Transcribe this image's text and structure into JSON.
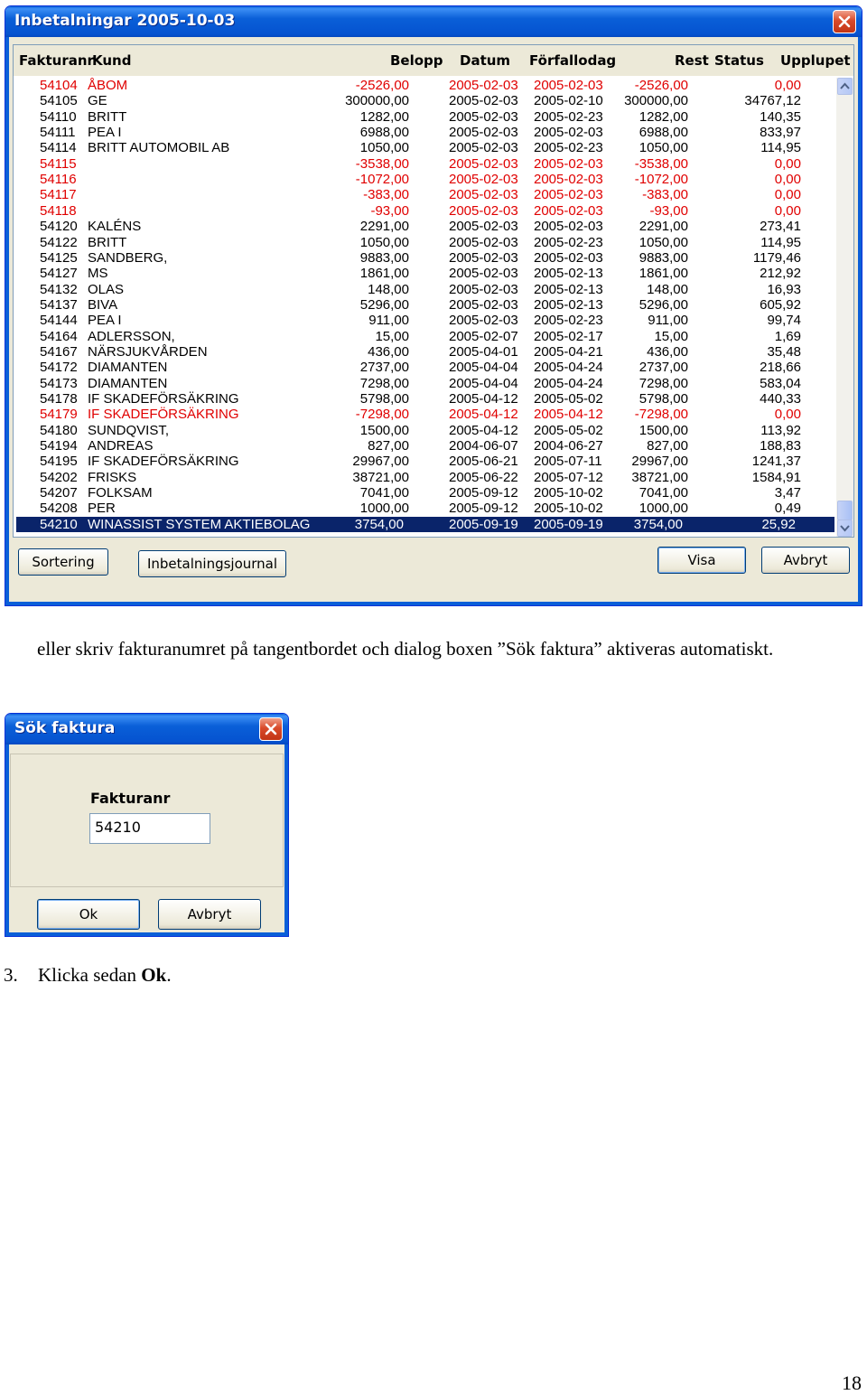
{
  "payments_window": {
    "title": "Inbetalningar 2005-10-03",
    "columns": [
      "Fakturanr",
      "Kund",
      "Belopp",
      "Datum",
      "Förfallodag",
      "Rest",
      "Status",
      "Upplupet"
    ],
    "rows": [
      {
        "nr": "54104",
        "kund": "ÅBOM",
        "belopp": "-2526,00",
        "datum": "2005-02-03",
        "forfall": "2005-02-03",
        "rest": "-2526,00",
        "upplupet": "0,00",
        "negative": true
      },
      {
        "nr": "54105",
        "kund": "GE",
        "belopp": "300000,00",
        "datum": "2005-02-03",
        "forfall": "2005-02-10",
        "rest": "300000,00",
        "upplupet": "34767,12",
        "negative": false
      },
      {
        "nr": "54110",
        "kund": "BRITT",
        "belopp": "1282,00",
        "datum": "2005-02-03",
        "forfall": "2005-02-23",
        "rest": "1282,00",
        "upplupet": "140,35",
        "negative": false
      },
      {
        "nr": "54111",
        "kund": "PEA I",
        "belopp": "6988,00",
        "datum": "2005-02-03",
        "forfall": "2005-02-03",
        "rest": "6988,00",
        "upplupet": "833,97",
        "negative": false
      },
      {
        "nr": "54114",
        "kund": "BRITT AUTOMOBIL AB",
        "belopp": "1050,00",
        "datum": "2005-02-03",
        "forfall": "2005-02-23",
        "rest": "1050,00",
        "upplupet": "114,95",
        "negative": false
      },
      {
        "nr": "54115",
        "kund": "",
        "belopp": "-3538,00",
        "datum": "2005-02-03",
        "forfall": "2005-02-03",
        "rest": "-3538,00",
        "upplupet": "0,00",
        "negative": true
      },
      {
        "nr": "54116",
        "kund": "",
        "belopp": "-1072,00",
        "datum": "2005-02-03",
        "forfall": "2005-02-03",
        "rest": "-1072,00",
        "upplupet": "0,00",
        "negative": true
      },
      {
        "nr": "54117",
        "kund": "",
        "belopp": "-383,00",
        "datum": "2005-02-03",
        "forfall": "2005-02-03",
        "rest": "-383,00",
        "upplupet": "0,00",
        "negative": true
      },
      {
        "nr": "54118",
        "kund": "",
        "belopp": "-93,00",
        "datum": "2005-02-03",
        "forfall": "2005-02-03",
        "rest": "-93,00",
        "upplupet": "0,00",
        "negative": true
      },
      {
        "nr": "54120",
        "kund": "KALÉNS",
        "belopp": "2291,00",
        "datum": "2005-02-03",
        "forfall": "2005-02-03",
        "rest": "2291,00",
        "upplupet": "273,41",
        "negative": false
      },
      {
        "nr": "54122",
        "kund": "BRITT",
        "belopp": "1050,00",
        "datum": "2005-02-03",
        "forfall": "2005-02-23",
        "rest": "1050,00",
        "upplupet": "114,95",
        "negative": false
      },
      {
        "nr": "54125",
        "kund": "SANDBERG,",
        "belopp": "9883,00",
        "datum": "2005-02-03",
        "forfall": "2005-02-03",
        "rest": "9883,00",
        "upplupet": "1179,46",
        "negative": false
      },
      {
        "nr": "54127",
        "kund": "MS",
        "belopp": "1861,00",
        "datum": "2005-02-03",
        "forfall": "2005-02-13",
        "rest": "1861,00",
        "upplupet": "212,92",
        "negative": false
      },
      {
        "nr": "54132",
        "kund": "OLAS",
        "belopp": "148,00",
        "datum": "2005-02-03",
        "forfall": "2005-02-13",
        "rest": "148,00",
        "upplupet": "16,93",
        "negative": false
      },
      {
        "nr": "54137",
        "kund": "BIVA",
        "belopp": "5296,00",
        "datum": "2005-02-03",
        "forfall": "2005-02-13",
        "rest": "5296,00",
        "upplupet": "605,92",
        "negative": false
      },
      {
        "nr": "54144",
        "kund": "PEA I",
        "belopp": "911,00",
        "datum": "2005-02-03",
        "forfall": "2005-02-23",
        "rest": "911,00",
        "upplupet": "99,74",
        "negative": false
      },
      {
        "nr": "54164",
        "kund": "ADLERSSON,",
        "belopp": "15,00",
        "datum": "2005-02-07",
        "forfall": "2005-02-17",
        "rest": "15,00",
        "upplupet": "1,69",
        "negative": false
      },
      {
        "nr": "54167",
        "kund": "NÄRSJUKVÅRDEN",
        "belopp": "436,00",
        "datum": "2005-04-01",
        "forfall": "2005-04-21",
        "rest": "436,00",
        "upplupet": "35,48",
        "negative": false
      },
      {
        "nr": "54172",
        "kund": "DIAMANTEN",
        "belopp": "2737,00",
        "datum": "2005-04-04",
        "forfall": "2005-04-24",
        "rest": "2737,00",
        "upplupet": "218,66",
        "negative": false
      },
      {
        "nr": "54173",
        "kund": "DIAMANTEN",
        "belopp": "7298,00",
        "datum": "2005-04-04",
        "forfall": "2005-04-24",
        "rest": "7298,00",
        "upplupet": "583,04",
        "negative": false
      },
      {
        "nr": "54178",
        "kund": "IF SKADEFÖRSÄKRING",
        "belopp": "5798,00",
        "datum": "2005-04-12",
        "forfall": "2005-05-02",
        "rest": "5798,00",
        "upplupet": "440,33",
        "negative": false
      },
      {
        "nr": "54179",
        "kund": "IF SKADEFÖRSÄKRING",
        "belopp": "-7298,00",
        "datum": "2005-04-12",
        "forfall": "2005-04-12",
        "rest": "-7298,00",
        "upplupet": "0,00",
        "negative": true
      },
      {
        "nr": "54180",
        "kund": "SUNDQVIST,",
        "belopp": "1500,00",
        "datum": "2005-04-12",
        "forfall": "2005-05-02",
        "rest": "1500,00",
        "upplupet": "113,92",
        "negative": false
      },
      {
        "nr": "54194",
        "kund": "ANDREAS",
        "belopp": "827,00",
        "datum": "2004-06-07",
        "forfall": "2004-06-27",
        "rest": "827,00",
        "upplupet": "188,83",
        "negative": false
      },
      {
        "nr": "54195",
        "kund": "IF SKADEFÖRSÄKRING",
        "belopp": "29967,00",
        "datum": "2005-06-21",
        "forfall": "2005-07-11",
        "rest": "29967,00",
        "upplupet": "1241,37",
        "negative": false
      },
      {
        "nr": "54202",
        "kund": "FRISKS",
        "belopp": "38721,00",
        "datum": "2005-06-22",
        "forfall": "2005-07-12",
        "rest": "38721,00",
        "upplupet": "1584,91",
        "negative": false
      },
      {
        "nr": "54207",
        "kund": "FOLKSAM",
        "belopp": "7041,00",
        "datum": "2005-09-12",
        "forfall": "2005-10-02",
        "rest": "7041,00",
        "upplupet": "3,47",
        "negative": false
      },
      {
        "nr": "54208",
        "kund": "PER",
        "belopp": "1000,00",
        "datum": "2005-09-12",
        "forfall": "2005-10-02",
        "rest": "1000,00",
        "upplupet": "0,49",
        "negative": false
      },
      {
        "nr": "54210",
        "kund": "WINASSIST SYSTEM AKTIEBOLAG",
        "belopp": "3754,00",
        "datum": "2005-09-19",
        "forfall": "2005-09-19",
        "rest": "3754,00",
        "upplupet": "25,92",
        "negative": false,
        "selected": true
      }
    ],
    "buttons": {
      "sortering": "Sortering",
      "inbetalningsjournal": "Inbetalningsjournal",
      "visa": "Visa",
      "avbryt": "Avbryt"
    }
  },
  "instruction_text": "eller skriv fakturanumret på tangentbordet och dialog boxen ”Sök faktura” aktiveras automatiskt.",
  "search_dialog": {
    "title": "Sök faktura",
    "label": "Fakturanr",
    "value": "54210",
    "ok_label": "Ok",
    "cancel_label": "Avbryt"
  },
  "step": {
    "number": "3.",
    "text": "Klicka sedan ",
    "bold": "Ok",
    "suffix": "."
  },
  "page_number": "18",
  "colors": {
    "titlebar": "#0a5fd8",
    "negative": "#e00000",
    "selection": "#0a246a",
    "window_bg": "#ece9d8"
  }
}
